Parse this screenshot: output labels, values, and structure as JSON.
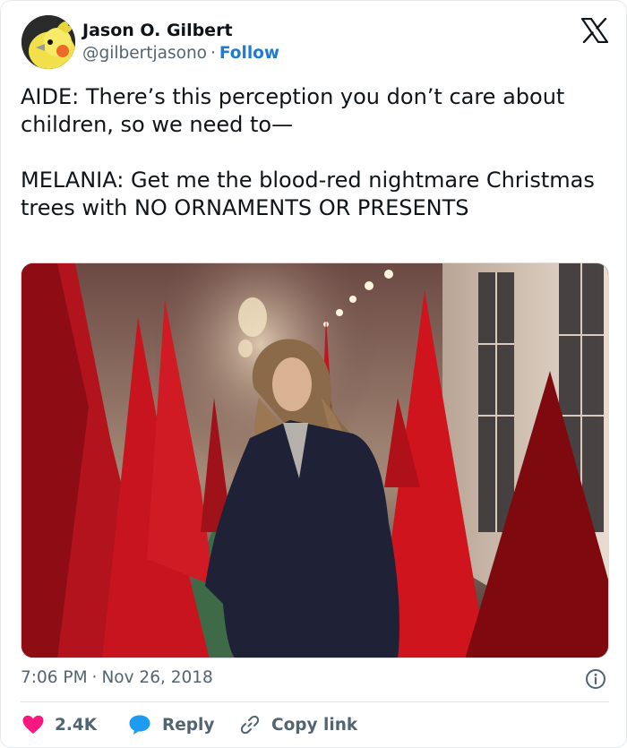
{
  "author": {
    "name": "Jason O. Gilbert",
    "handle": "@gilbertjasono",
    "separator": "·",
    "follow_label": "Follow",
    "avatar_icon": "cockatiel-avatar"
  },
  "platform_icon": "x-logo-icon",
  "tweet": {
    "text": "AIDE: There’s this perception you don’t care about children, so we need to—\n\nMELANIA: Get me the blood-red nightmare Christmas trees with NO ORNAMENTS OR PRESENTS"
  },
  "media": {
    "description_icon": "photo-red-christmas-trees-hallway"
  },
  "meta": {
    "time": "7:06 PM",
    "separator": "·",
    "date": "Nov 26, 2018",
    "info_icon": "info-icon"
  },
  "actions": {
    "like_count": "2.4K",
    "reply_label": "Reply",
    "copy_label": "Copy link"
  },
  "colors": {
    "link_blue": "#1d7bd6",
    "like_red": "#f91880",
    "reply_blue": "#1d9bf0",
    "muted": "#536471",
    "text": "#0f1419"
  }
}
